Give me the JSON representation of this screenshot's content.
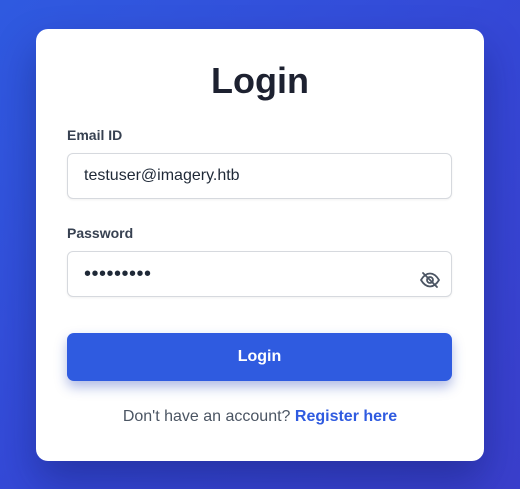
{
  "login_form": {
    "title": "Login",
    "email": {
      "label": "Email ID",
      "value": "testuser@imagery.htb"
    },
    "password": {
      "label": "Password",
      "value": "•••••••••",
      "toggle_icon": "eye-off-icon"
    },
    "submit_label": "Login",
    "footer": {
      "prompt": "Don't have an account?",
      "link_label": "Register here"
    }
  },
  "colors": {
    "background": "#3547d6",
    "accent": "#2f5be0",
    "title": "#1d2130"
  }
}
